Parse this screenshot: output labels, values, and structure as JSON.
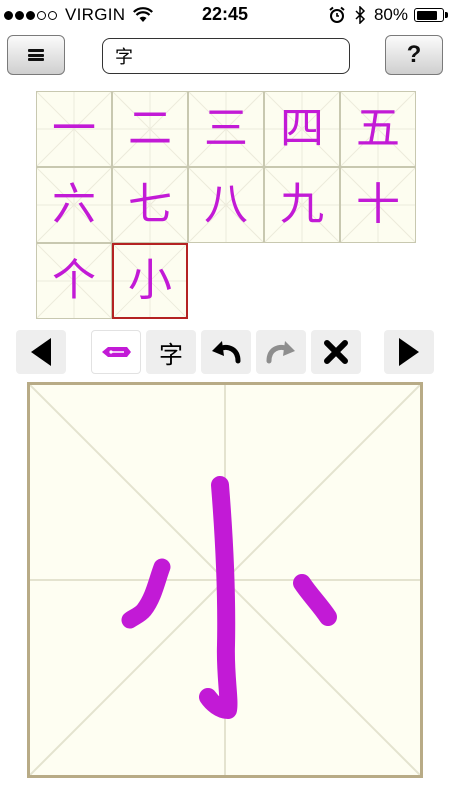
{
  "status_bar": {
    "carrier": "VIRGIN",
    "signal_bars_filled": 3,
    "signal_bars_total": 5,
    "time": "22:45",
    "battery_percent": "80%",
    "battery_level": 0.8,
    "icons": [
      "wifi-icon",
      "alarm-icon",
      "bluetooth-icon",
      "battery-icon"
    ]
  },
  "toolbar": {
    "menu_icon": "hamburger-menu-icon",
    "search_value": "字",
    "help_label": "?"
  },
  "characters": [
    "一",
    "二",
    "三",
    "四",
    "五",
    "六",
    "七",
    "八",
    "九",
    "十",
    "个",
    "小"
  ],
  "selected_character": "小",
  "controls": {
    "prev_icon": "triangle-left-icon",
    "pen_icon": "pen-icon",
    "char_toggle_label": "字",
    "undo_icon": "undo-icon",
    "redo_icon": "redo-icon",
    "clear_icon": "x-icon",
    "next_icon": "triangle-right-icon"
  },
  "colors": {
    "ink": "#c21ad6",
    "grid_bg": "#fdfdf0",
    "canvas_border": "#b8ab86",
    "selection": "#b42222"
  }
}
